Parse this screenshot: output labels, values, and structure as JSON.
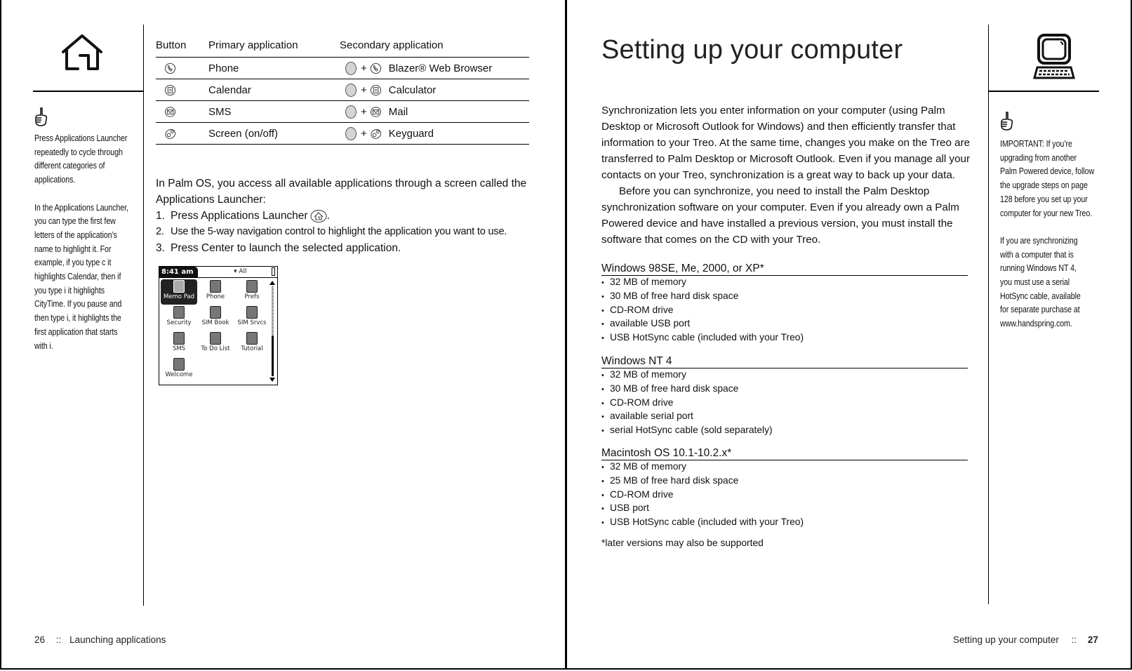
{
  "left_page": {
    "sidebar_note": "Press Applications Launcher\nrepeatedly to cycle through\ndifferent categories of\napplications.\n\nIn the Applications Launcher,\nyou can type the first few\nletters of the application’s\nname to highlight it. For\nexample, if you type c it\nhighlights Calendar, then if\nyou type i it highlights\nCityTime. If you pause and\nthen type i, it highlights the\nfirst application that starts\nwith i.",
    "table": {
      "headers": [
        "Button",
        "Primary application",
        "Secondary application"
      ],
      "rows": [
        {
          "button_icon": "phone-button-icon",
          "primary": "Phone",
          "secondary": "Blazer® Web Browser"
        },
        {
          "button_icon": "calendar-button-icon",
          "primary": "Calendar",
          "secondary": "Calculator"
        },
        {
          "button_icon": "sms-button-icon",
          "primary": "SMS",
          "secondary": "Mail"
        },
        {
          "button_icon": "screen-button-icon",
          "primary": "Screen (on/off)",
          "secondary": "Keyguard"
        }
      ],
      "plus": "+"
    },
    "intro_line1": "In Palm OS, you access all available applications through a screen called the",
    "intro_line2": "Applications Launcher:",
    "steps": [
      {
        "num": "1.",
        "text": "Press Applications Launcher",
        "suffix": "."
      },
      {
        "num": "2.",
        "text": "Use the 5-way navigation control to highlight the application you want to use."
      },
      {
        "num": "3.",
        "text": "Press Center to launch the selected application."
      }
    ],
    "palm_screen": {
      "time": "8:41 am",
      "category": "▾ All",
      "apps": [
        "Memo Pad",
        "Phone",
        "Prefs",
        "Security",
        "SIM Book",
        "SIM Srvcs",
        "SMS",
        "To Do List",
        "Tutorial",
        "Welcome"
      ],
      "selected_app": "Memo Pad"
    },
    "footer": {
      "page_number": "26",
      "separator": "::",
      "section": "Launching applications"
    }
  },
  "right_page": {
    "title": "Setting up your computer",
    "intro_p1": "Synchronization lets you enter information on your computer (using Palm Desktop or Microsoft Outlook for Windows) and then efficiently transfer that information to your Treo. At the same time, changes you make on the Treo are transferred to Palm Desktop or Microsoft Outlook. Even if you manage all your contacts on your Treo, synchronization is a great way to back up your data.",
    "intro_p2": "Before you can synchronize, you need to install the Palm Desktop synchronization software on your computer. Even if you already own a Palm Powered device and have installed a previous version, you must install the software that comes on the CD with your Treo.",
    "requirements": [
      {
        "title": "Windows 98SE, Me, 2000, or XP*",
        "items": [
          "32 MB of memory",
          "30 MB of free hard disk space",
          "CD-ROM drive",
          "available USB port",
          "USB HotSync cable (included with your Treo)"
        ]
      },
      {
        "title": "Windows NT 4",
        "items": [
          "32 MB of memory",
          "30 MB of free hard disk space",
          "CD-ROM drive",
          "available serial port",
          "serial HotSync cable (sold separately)"
        ]
      },
      {
        "title": "Macintosh OS 10.1-10.2.x*",
        "items": [
          "32 MB of memory",
          "25 MB of free hard disk space",
          "CD-ROM drive",
          "USB port",
          "USB HotSync cable (included with your Treo)"
        ]
      }
    ],
    "footnote": "*later versions may also be supported",
    "sidebar_note": "IMPORTANT: If you’re\nupgrading from another\nPalm Powered device, follow\nthe upgrade steps on page\n128 before you set up your\ncomputer for your new Treo.\n\nIf you are synchronizing\nwith a computer that is\nrunning Windows NT 4,\nyou must use a serial\nHotSync cable, available\nfor separate purchase at\nwww.handspring.com.",
    "footer": {
      "section": "Setting up your computer",
      "separator": "::",
      "page_number": "27"
    }
  }
}
